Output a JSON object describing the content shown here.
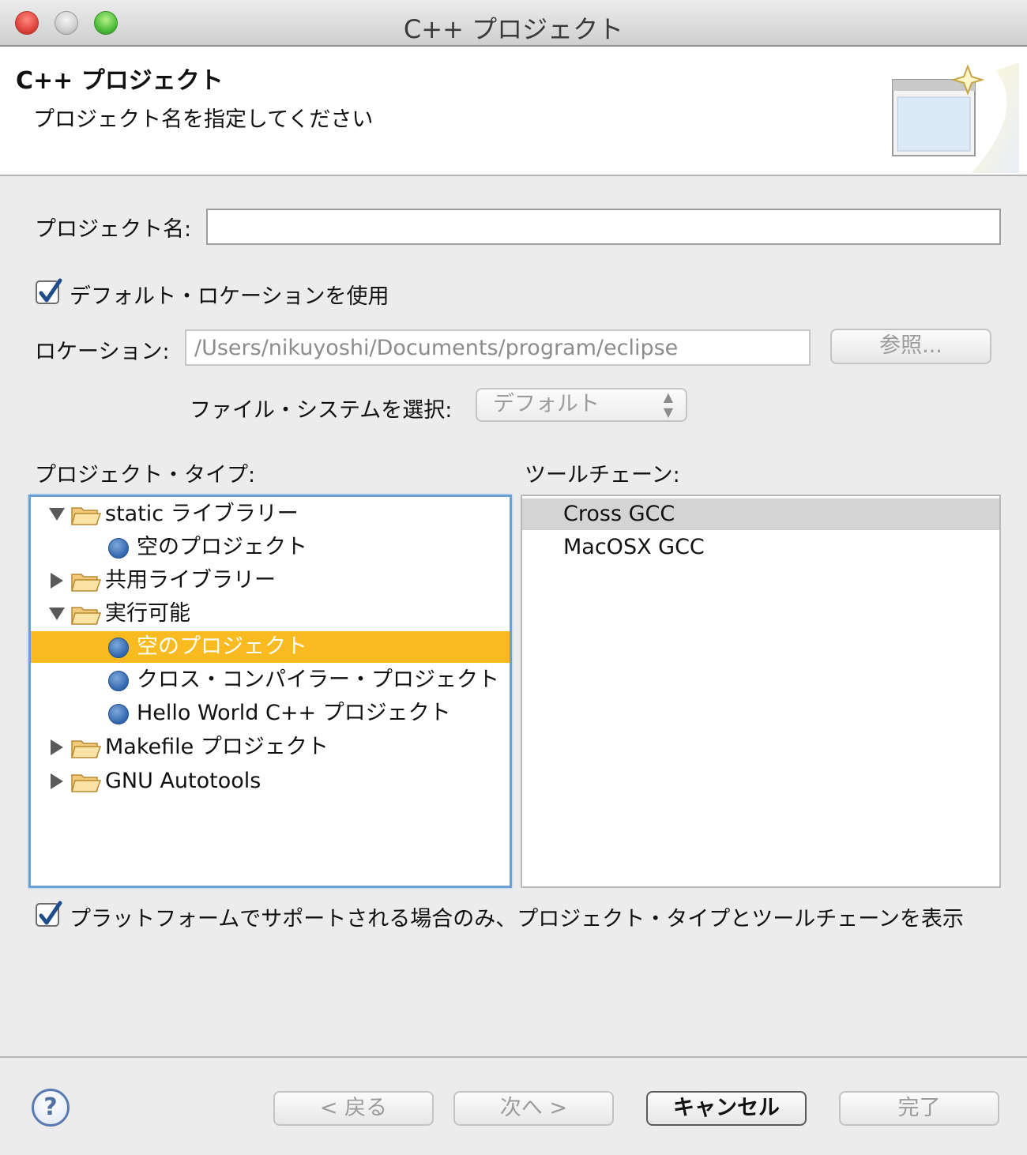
{
  "window": {
    "title": "C++ プロジェクト"
  },
  "header": {
    "title": "C++ プロジェクト",
    "subtitle": "プロジェクト名を指定してください"
  },
  "form": {
    "project_name_label": "プロジェクト名:",
    "project_name_value": "",
    "use_default_location_label": "デフォルト・ロケーションを使用",
    "use_default_location_checked": true,
    "location_label": "ロケーション:",
    "location_value": "/Users/nikuyoshi/Documents/program/eclipse",
    "browse_button": "参照...",
    "filesystem_label": "ファイル・システムを選択:",
    "filesystem_value": "デフォルト"
  },
  "project_types": {
    "label": "プロジェクト・タイプ:",
    "items": [
      {
        "label": "static ライブラリー",
        "kind": "folder",
        "expanded": true
      },
      {
        "label": "空のプロジェクト",
        "kind": "item"
      },
      {
        "label": "共用ライブラリー",
        "kind": "folder",
        "expanded": false
      },
      {
        "label": "実行可能",
        "kind": "folder",
        "expanded": true
      },
      {
        "label": "空のプロジェクト",
        "kind": "item",
        "selected": true
      },
      {
        "label": "クロス・コンパイラー・プロジェクト",
        "kind": "item"
      },
      {
        "label": "Hello World C++ プロジェクト",
        "kind": "item"
      },
      {
        "label": "Makefile プロジェクト",
        "kind": "folder",
        "expanded": false
      },
      {
        "label": "GNU Autotools",
        "kind": "folder",
        "expanded": false
      }
    ]
  },
  "toolchains": {
    "label": "ツールチェーン:",
    "items": [
      {
        "label": "Cross GCC",
        "selected": true
      },
      {
        "label": "MacOSX GCC"
      }
    ]
  },
  "filter_checkbox": {
    "label": "プラットフォームでサポートされる場合のみ、プロジェクト・タイプとツールチェーンを表示",
    "checked": true
  },
  "footer": {
    "back_button": "< 戻る",
    "next_button": "次へ >",
    "cancel_button": "キャンセル",
    "finish_button": "完了",
    "help_icon": "?"
  },
  "colors": {
    "selection": "#f9bb1f",
    "focus_ring": "#6b9fd8",
    "toolchain_selection": "#d4d4d4"
  }
}
